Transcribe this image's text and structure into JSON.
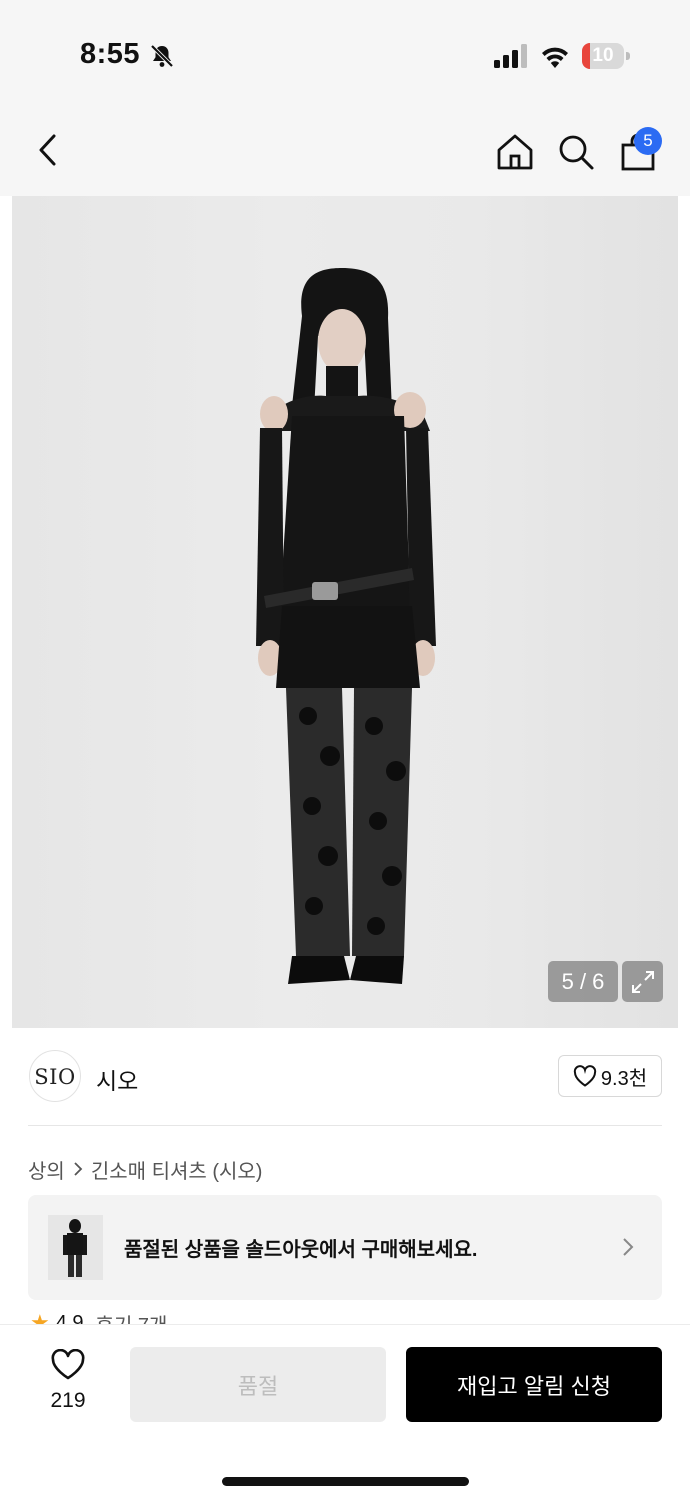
{
  "status_bar": {
    "time": "8:55",
    "battery_level": "10",
    "icons": [
      "bell-slash-icon",
      "cellular-signal-icon",
      "wifi-icon",
      "battery-icon"
    ]
  },
  "nav": {
    "icons": [
      "chevron-left-icon",
      "home-icon",
      "search-icon",
      "shopping-bag-icon"
    ],
    "cart_count": "5"
  },
  "gallery": {
    "counter": "5 / 6",
    "current_index": 5,
    "total": 6,
    "expand_icon": "expand-arrows-icon"
  },
  "brand": {
    "logo_text": "SIO",
    "name": "시오",
    "likes": "9.3천"
  },
  "breadcrumb": {
    "category": "상의",
    "subcategory": "긴소매 티셔츠 (시오)"
  },
  "soldout_banner": {
    "text": "품절된 상품을 솔드아웃에서 구매해보세요."
  },
  "rating": {
    "score": "4.9",
    "reviews": "후기 7개"
  },
  "bottom_bar": {
    "wishlist_count": "219",
    "soldout_label": "품절",
    "restock_label": "재입고 알림 신청"
  },
  "colors": {
    "badge": "#2b6bf3",
    "battery_low": "#e8453c",
    "star": "#f6a623",
    "primary_button": "#000000",
    "disabled_button": "#ececec"
  }
}
